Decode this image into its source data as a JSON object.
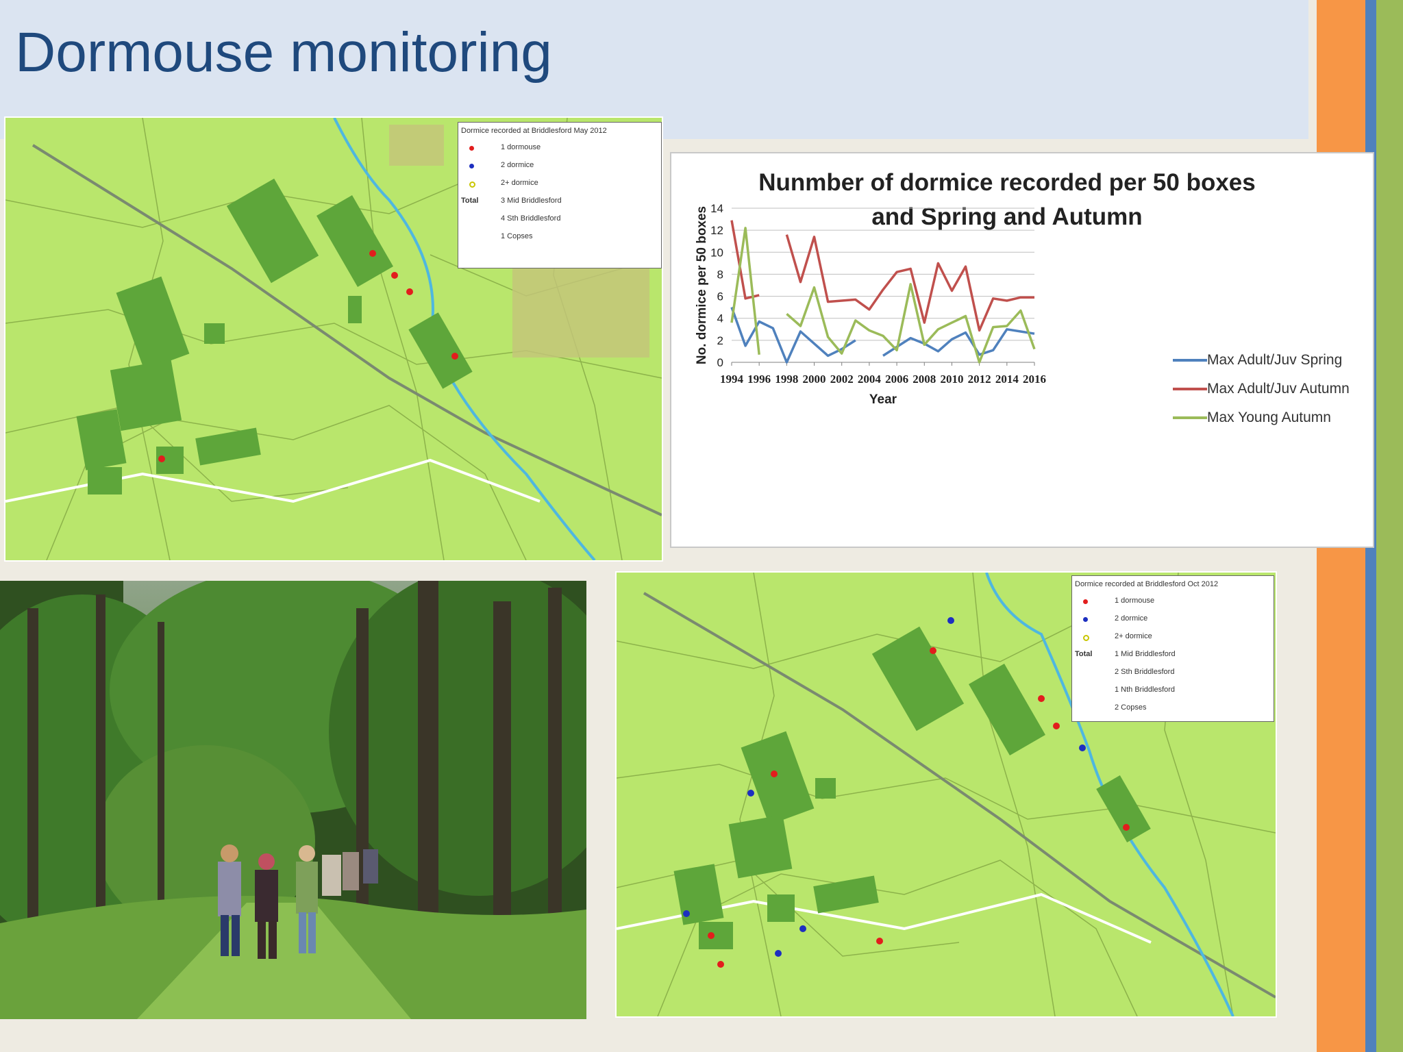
{
  "slide": {
    "title": "Dormouse monitoring"
  },
  "colors": {
    "title": "#1f497d",
    "band": "#dbe4f1",
    "orange": "#f79646",
    "blue": "#4f81bd",
    "green": "#9bbb59"
  },
  "map_may": {
    "legend_title": "Dormice recorded at Briddlesford May 2012",
    "rows": [
      "1 dormouse",
      "2 dormice",
      "2+ dormice"
    ],
    "total_label": "Total",
    "totals": [
      "3 Mid Briddlesford",
      "4 Sth Briddlesford",
      "1 Copses"
    ]
  },
  "map_oct": {
    "legend_title": "Dormice recorded at Briddlesford Oct 2012",
    "rows": [
      "1 dormouse",
      "2 dormice",
      "2+ dormice"
    ],
    "total_label": "Total",
    "totals": [
      "1 Mid Briddlesford",
      "2 Sth Briddlesford",
      "1 Nth Briddlesford",
      "2 Copses"
    ]
  },
  "chart_data": {
    "type": "line",
    "title_line1": "Nunmber of dormice recorded per 50 boxes",
    "title_line2": "and Spring and Autumn",
    "xlabel": "Year",
    "ylabel": "No. dormice per 50 boxes",
    "ylim": [
      0,
      14
    ],
    "yticks": [
      "0",
      "2",
      "4",
      "6",
      "8",
      "10",
      "12",
      "14"
    ],
    "xticks": [
      "1994",
      "1996",
      "1998",
      "2000",
      "2002",
      "2004",
      "2006",
      "2008",
      "2010",
      "2012",
      "2014",
      "2016"
    ],
    "x": [
      1994,
      1995,
      1996,
      1997,
      1998,
      1999,
      2000,
      2001,
      2002,
      2003,
      2004,
      2005,
      2006,
      2007,
      2008,
      2009,
      2010,
      2011,
      2012,
      2013,
      2014,
      2015,
      2016
    ],
    "grid": true,
    "legend_position": "right",
    "series": [
      {
        "name": "Max Adult/Juv Spring",
        "color": "#4f81bd",
        "values": [
          5.0,
          1.5,
          3.7,
          3.1,
          0.0,
          2.8,
          1.7,
          0.6,
          1.2,
          2.0,
          null,
          0.6,
          1.4,
          2.2,
          1.7,
          1.0,
          2.1,
          2.7,
          0.7,
          1.1,
          3.0,
          2.8,
          2.6
        ]
      },
      {
        "name": "Max Adult/Juv Autumn",
        "color": "#c0504d",
        "values": [
          12.9,
          5.8,
          6.1,
          null,
          11.6,
          7.3,
          11.4,
          5.5,
          5.6,
          5.7,
          4.8,
          6.6,
          8.2,
          8.5,
          3.6,
          9.0,
          6.5,
          8.7,
          2.9,
          5.8,
          5.6,
          5.9,
          5.9
        ]
      },
      {
        "name": "Max Young Autumn",
        "color": "#9bbb59",
        "values": [
          3.6,
          12.2,
          0.7,
          null,
          4.4,
          3.3,
          6.8,
          2.3,
          0.8,
          3.8,
          2.9,
          2.4,
          1.1,
          7.1,
          1.6,
          3.0,
          3.6,
          4.2,
          0.0,
          3.2,
          3.3,
          4.7,
          1.2
        ]
      }
    ]
  }
}
